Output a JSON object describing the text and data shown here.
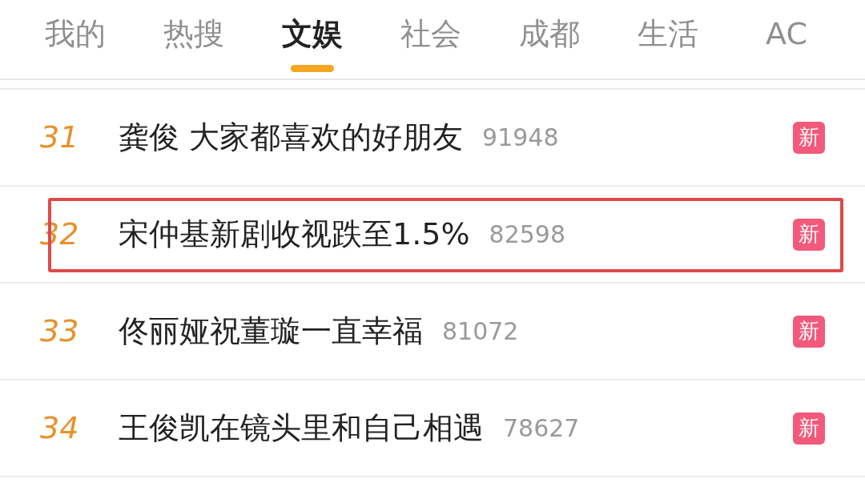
{
  "tabs": [
    {
      "label": "我的",
      "selected": false
    },
    {
      "label": "热搜",
      "selected": false
    },
    {
      "label": "文娱",
      "selected": true
    },
    {
      "label": "社会",
      "selected": false
    },
    {
      "label": "成都",
      "selected": false
    },
    {
      "label": "生活",
      "selected": false
    },
    {
      "label": "AC",
      "selected": false
    }
  ],
  "rows": [
    {
      "rank": "31",
      "title": "龚俊 大家都喜欢的好朋友",
      "count": "91948",
      "badge": "新",
      "highlighted": false
    },
    {
      "rank": "32",
      "title": "宋仲基新剧收视跌至1.5%",
      "count": "82598",
      "badge": "新",
      "highlighted": true
    },
    {
      "rank": "33",
      "title": "佟丽娅祝董璇一直幸福",
      "count": "81072",
      "badge": "新",
      "highlighted": false
    },
    {
      "rank": "34",
      "title": "王俊凯在镜头里和自己相遇",
      "count": "78627",
      "badge": "新",
      "highlighted": false
    }
  ]
}
